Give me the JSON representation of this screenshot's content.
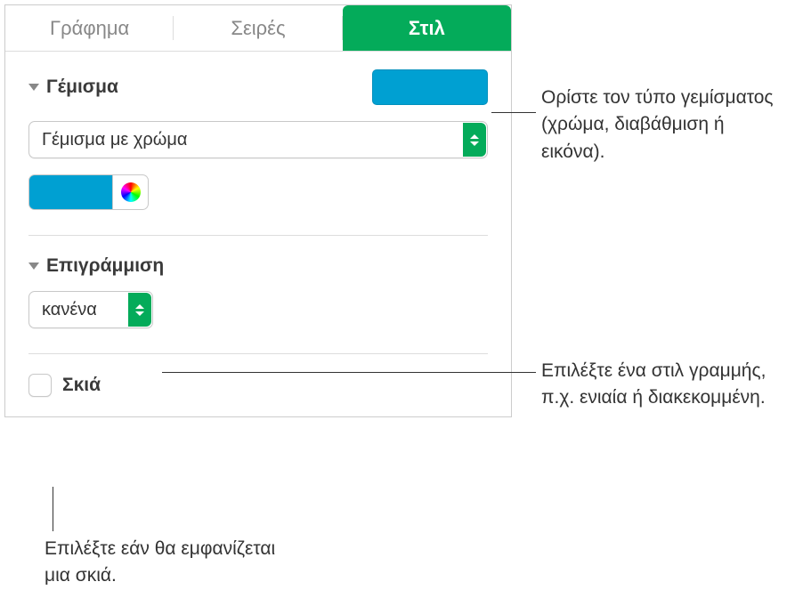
{
  "tabs": {
    "chart": "Γράφημα",
    "series": "Σειρές",
    "style": "Στιλ"
  },
  "sections": {
    "fill": {
      "title": "Γέμισμα",
      "preview_color": "#00a0d2",
      "dropdown_value": "Γέμισμα με χρώμα",
      "swatch_color": "#00a0d2"
    },
    "stroke": {
      "title": "Επιγράμμιση",
      "dropdown_value": "κανένα"
    },
    "shadow": {
      "label": "Σκιά",
      "checked": false
    }
  },
  "callouts": {
    "fill_type": "Ορίστε τον τύπο γεμίσματος (χρώμα, διαβάθμιση ή εικόνα).",
    "line_style": "Επιλέξτε ένα στιλ γραμμής, π.χ. ενιαία ή διακεκομμένη.",
    "shadow_toggle": "Επιλέξτε εάν θα εμφανίζεται μια σκιά."
  }
}
